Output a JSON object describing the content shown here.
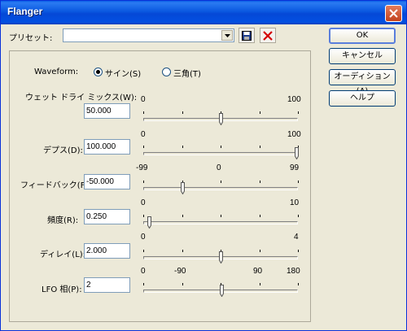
{
  "window": {
    "title": "Flanger"
  },
  "preset": {
    "label": "プリセット:",
    "value": ""
  },
  "buttons": {
    "ok": "OK",
    "cancel": "キャンセル",
    "audition": "オーディション(A)",
    "help": "ヘルプ"
  },
  "waveform": {
    "label": "Waveform:",
    "options": [
      {
        "label": "サイン(S)",
        "selected": true
      },
      {
        "label": "三角(T)",
        "selected": false
      }
    ]
  },
  "params": [
    {
      "label": "ウェット ドライ ミックス(W):",
      "value": "50.000",
      "scale": [
        "0",
        "100"
      ],
      "min": 0,
      "max": 100,
      "current": 50
    },
    {
      "label": "デプス(D):",
      "value": "100.000",
      "scale": [
        "0",
        "100"
      ],
      "min": 0,
      "max": 100,
      "current": 100
    },
    {
      "label": "フィードバック(F):",
      "value": "-50.000",
      "scale": [
        "-99",
        "0",
        "99"
      ],
      "min": -99,
      "max": 99,
      "current": -50
    },
    {
      "label": "頻度(R):",
      "value": "0.250",
      "scale": [
        "0",
        "10"
      ],
      "min": 0,
      "max": 10,
      "current": 0.25
    },
    {
      "label": "ディレイ(L):",
      "value": "2.000",
      "scale": [
        "0",
        "4"
      ],
      "min": 0,
      "max": 4,
      "current": 2
    },
    {
      "label": "LFO 相(P):",
      "value": "2",
      "scale": [
        "0",
        "-90",
        "90",
        "180"
      ],
      "min": -180,
      "max": 180,
      "current": 2
    }
  ]
}
